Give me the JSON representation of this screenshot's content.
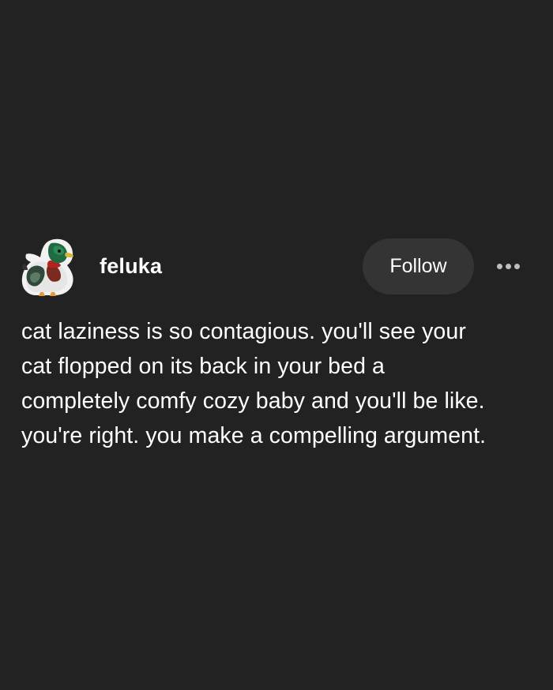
{
  "post": {
    "author": {
      "username": "feluka",
      "avatar_icon": "mallard-duck-avatar-icon"
    },
    "follow_label": "Follow",
    "more_icon": "more-options-icon",
    "body": "cat laziness is so contagious. you'll see your\ncat flopped on its back in your bed a\ncompletely comfy cozy baby and you'll be like.\nyou're right. you make a compelling argument."
  },
  "colors": {
    "background": "#222222",
    "follow_button_bg": "#343434",
    "text": "#ffffff",
    "more_dots": "#bdbdbd"
  }
}
